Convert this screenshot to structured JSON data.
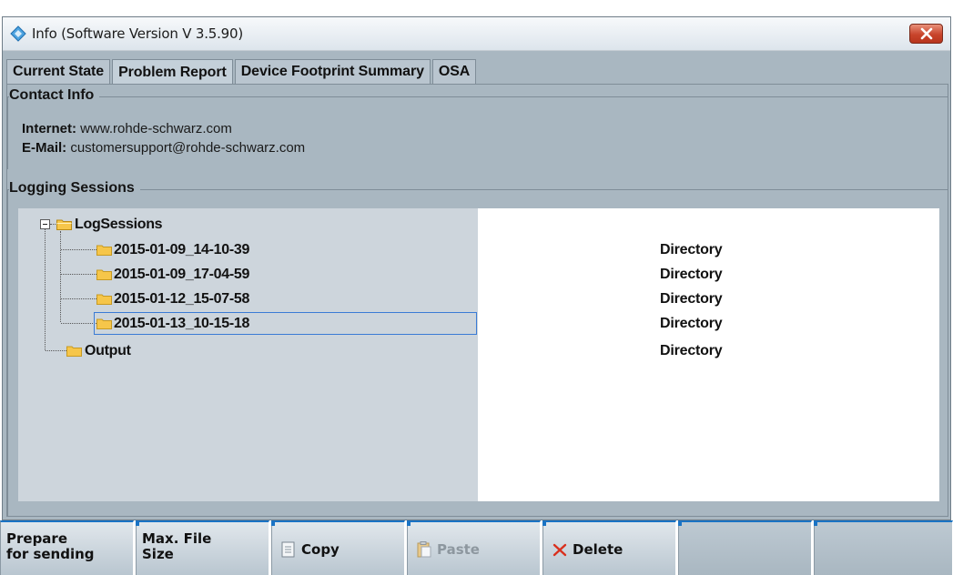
{
  "window": {
    "title": "Info (Software Version V 3.5.90)",
    "icons": {
      "app": "app-diamond-icon",
      "close": "close-x-icon"
    }
  },
  "tabs": [
    {
      "label": "Current State",
      "active": false
    },
    {
      "label": "Problem Report",
      "active": true
    },
    {
      "label": "Device Footprint Summary",
      "active": false
    },
    {
      "label": "OSA",
      "active": false
    }
  ],
  "contact_info": {
    "title": "Contact Info",
    "internet_label": "Internet:",
    "internet_value": "www.rohde-schwarz.com",
    "email_label": "E-Mail:",
    "email_value": "customersupport@rohde-schwarz.com"
  },
  "logging": {
    "title": "Logging Sessions",
    "root": {
      "label": "LogSessions",
      "type": ""
    },
    "sessions": [
      {
        "label": "2015-01-09_14-10-39",
        "type": "Directory",
        "selected": false
      },
      {
        "label": "2015-01-09_17-04-59",
        "type": "Directory",
        "selected": false
      },
      {
        "label": "2015-01-12_15-07-58",
        "type": "Directory",
        "selected": false
      },
      {
        "label": "2015-01-13_10-15-18",
        "type": "Directory",
        "selected": true
      }
    ],
    "output": {
      "label": "Output",
      "type": "Directory"
    }
  },
  "softkeys": [
    {
      "line1": "Prepare",
      "line2": "for sending"
    },
    {
      "line1": "Max. File",
      "line2": "Size"
    },
    {
      "label": "Copy",
      "icon": "copy-document-icon"
    },
    {
      "label": "Paste",
      "icon": "paste-clipboard-icon",
      "disabled": true
    },
    {
      "label": "Delete",
      "icon": "delete-x-icon"
    },
    {
      "label": ""
    },
    {
      "label": ""
    }
  ],
  "colors": {
    "dialog_bg": "#a9b7c1",
    "tree_bg": "#cdd5dc",
    "softkey_accent": "#1a73c4",
    "selection_border": "#3a7bd5",
    "folder": "#f6c64a",
    "delete_icon": "#d9301e"
  }
}
